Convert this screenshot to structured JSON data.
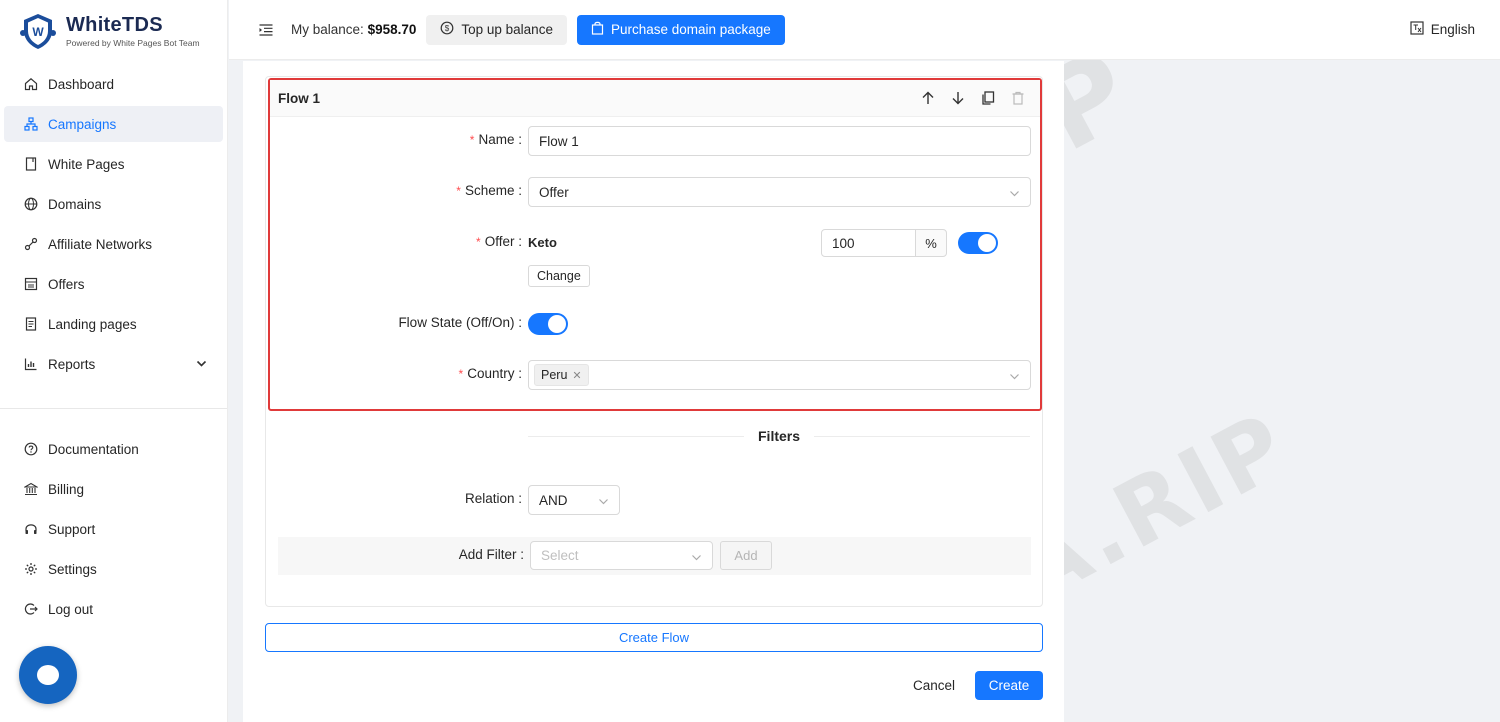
{
  "brand": {
    "name": "WhiteTDS",
    "tagline": "Powered by White Pages Bot Team"
  },
  "sidebar": {
    "items": [
      {
        "label": "Dashboard",
        "icon": "home-icon"
      },
      {
        "label": "Campaigns",
        "icon": "sitemap-icon",
        "active": true
      },
      {
        "label": "White Pages",
        "icon": "page-icon"
      },
      {
        "label": "Domains",
        "icon": "globe-icon"
      },
      {
        "label": "Affiliate Networks",
        "icon": "link-icon"
      },
      {
        "label": "Offers",
        "icon": "shop-icon"
      },
      {
        "label": "Landing pages",
        "icon": "file-icon"
      },
      {
        "label": "Reports",
        "icon": "bar-chart-icon"
      }
    ],
    "bottom_items": [
      {
        "label": "Documentation",
        "icon": "question-icon"
      },
      {
        "label": "Billing",
        "icon": "bank-icon"
      },
      {
        "label": "Support",
        "icon": "headset-icon"
      },
      {
        "label": "Settings",
        "icon": "gear-icon"
      },
      {
        "label": "Log out",
        "icon": "logout-icon"
      }
    ]
  },
  "header": {
    "balance_label": "My balance:",
    "balance_value": "$958.70",
    "topup_label": "Top up balance",
    "purchase_label": "Purchase domain package",
    "language": "English"
  },
  "flow": {
    "title": "Flow 1",
    "name_label": "Name",
    "name_value": "Flow 1",
    "scheme_label": "Scheme",
    "scheme_value": "Offer",
    "offer_label": "Offer",
    "offer_value": "Keto",
    "offer_percent": "100",
    "percent_suffix": "%",
    "change_label": "Change",
    "state_label": "Flow State (Off/On)",
    "country_label": "Country",
    "country_tag": "Peru"
  },
  "filters": {
    "title": "Filters",
    "relation_label": "Relation",
    "relation_value": "AND",
    "add_filter_label": "Add Filter",
    "select_placeholder": "Select",
    "add_label": "Add"
  },
  "actions": {
    "create_flow": "Create Flow",
    "cancel": "Cancel",
    "create": "Create"
  },
  "colors": {
    "accent": "#1677ff",
    "highlight_border": "#e03a3a",
    "required": "#ff4d4f"
  }
}
